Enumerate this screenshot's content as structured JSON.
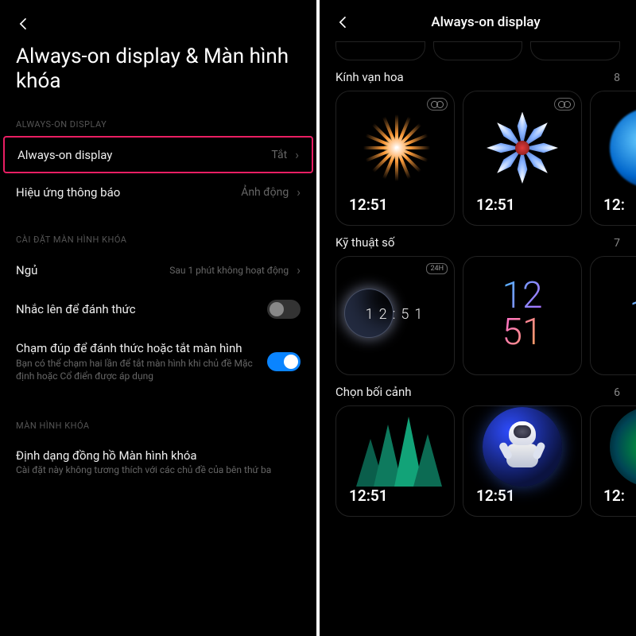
{
  "left": {
    "title": "Always-on display & Màn hình khóa",
    "sections": {
      "aod_label": "ALWAYS-ON DISPLAY",
      "lock_settings_label": "CÀI ĐẶT MÀN HÌNH KHÓA",
      "lock_screen_label": "MÀN HÌNH KHÓA"
    },
    "rows": {
      "aod": {
        "label": "Always-on display",
        "value": "Tắt"
      },
      "notif_effect": {
        "label": "Hiệu ứng thông báo",
        "value": "Ảnh động"
      },
      "sleep": {
        "label": "Ngủ",
        "value": "Sau 1 phút không hoạt động"
      },
      "raise_wake": {
        "label": "Nhắc lên để đánh thức",
        "state": "off"
      },
      "double_tap": {
        "label": "Chạm đúp để đánh thức hoặc tắt màn hình",
        "sub": "Bạn có thể chạm hai lần để tắt màn hình khi chủ đề Mặc định hoặc Cổ điển được áp dụng",
        "state": "on"
      },
      "clock_format": {
        "label": "Định dạng đồng hồ Màn hình khóa",
        "sub": "Cài đặt này không tương thích với các chủ đề của bên thứ ba"
      }
    }
  },
  "right": {
    "title": "Always-on display",
    "categories": [
      {
        "name": "Kính vạn hoa",
        "count": "8"
      },
      {
        "name": "Kỹ thuật số",
        "count": "7"
      },
      {
        "name": "Chọn bối cảnh",
        "count": "6"
      }
    ],
    "time": "12:51",
    "time_spaced": "12:51",
    "time_stack_top": "12",
    "time_stack_bottom": "51",
    "partial_time": "12:",
    "partial_stack": "12",
    "badge_24h": "24H"
  }
}
